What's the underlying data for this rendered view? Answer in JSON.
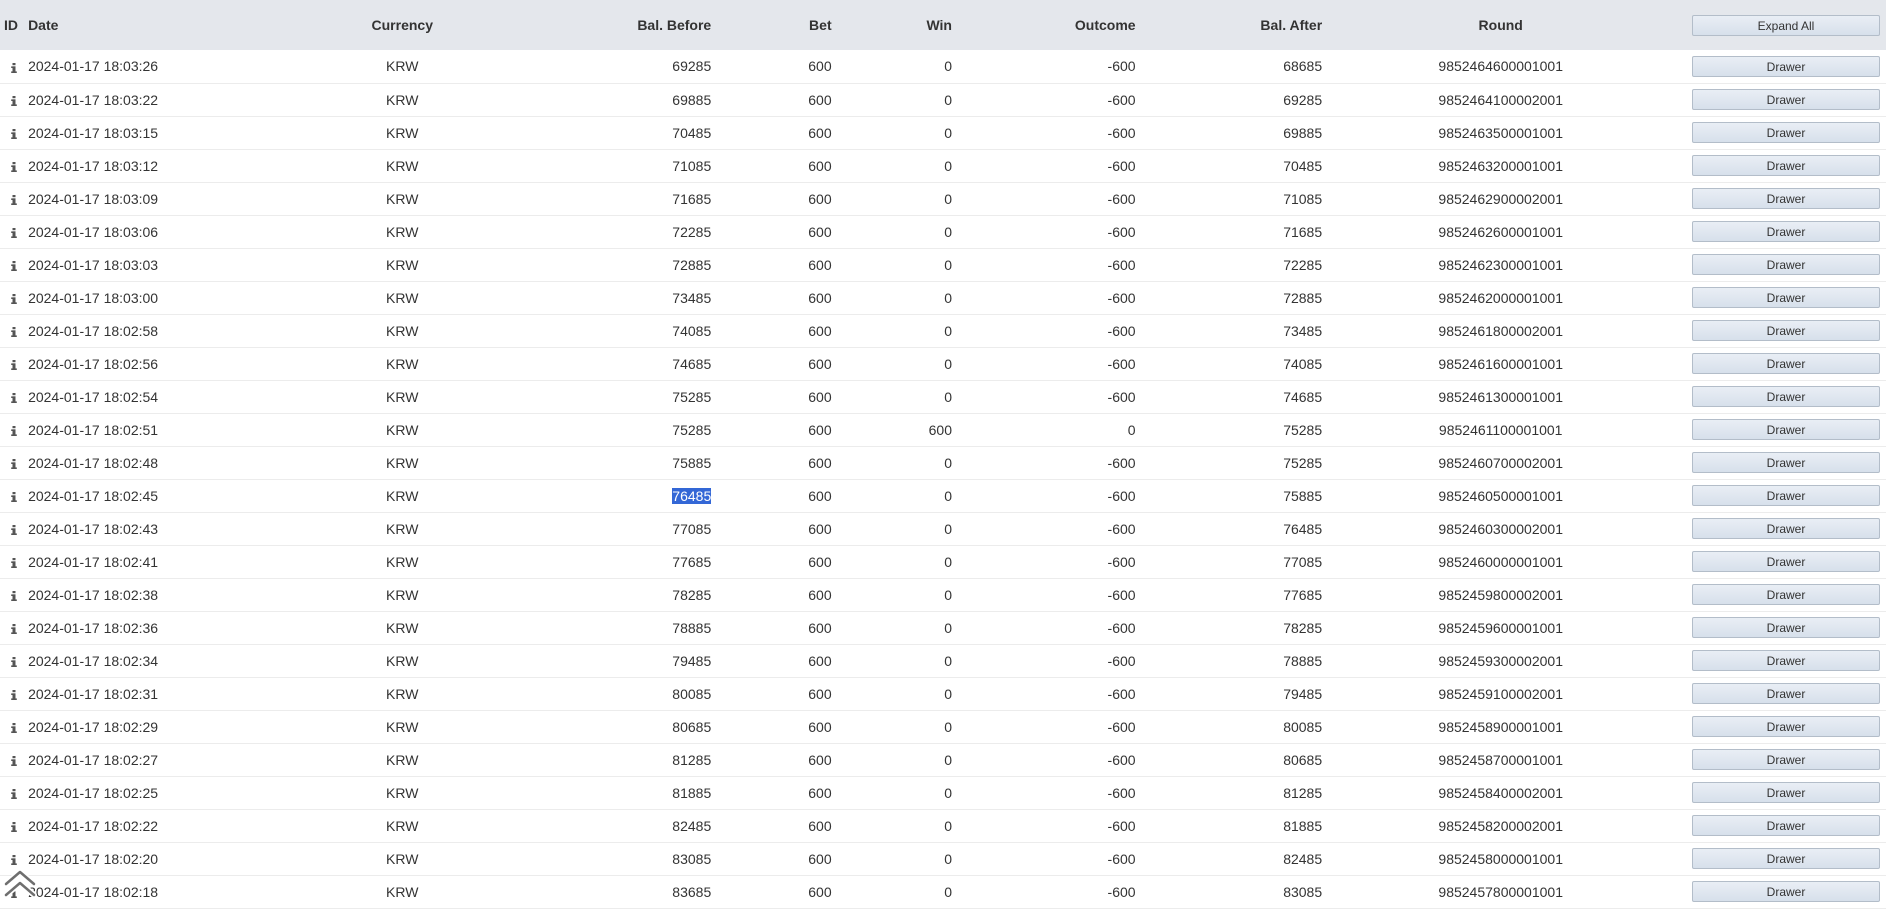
{
  "columns": {
    "id": "ID",
    "date": "Date",
    "currency": "Currency",
    "bal_before": "Bal. Before",
    "bet": "Bet",
    "win": "Win",
    "outcome": "Outcome",
    "bal_after": "Bal. After",
    "round": "Round"
  },
  "expand_all_label": "Expand All",
  "row_button_label": "Drawer",
  "icons": {
    "row_info": "info-icon",
    "scroll_top": "double-chevron-up-icon"
  },
  "colors": {
    "header_bg": "#e4e7ec",
    "selection": "#3367d6"
  },
  "selected_cell": {
    "row": 13,
    "column": "bal_before"
  },
  "rows": [
    {
      "date": "2024-01-17 18:03:26",
      "currency": "KRW",
      "bal_before": "69285",
      "bet": "600",
      "win": "0",
      "outcome": "-600",
      "bal_after": "68685",
      "round": "9852464600001001"
    },
    {
      "date": "2024-01-17 18:03:22",
      "currency": "KRW",
      "bal_before": "69885",
      "bet": "600",
      "win": "0",
      "outcome": "-600",
      "bal_after": "69285",
      "round": "9852464100002001"
    },
    {
      "date": "2024-01-17 18:03:15",
      "currency": "KRW",
      "bal_before": "70485",
      "bet": "600",
      "win": "0",
      "outcome": "-600",
      "bal_after": "69885",
      "round": "9852463500001001"
    },
    {
      "date": "2024-01-17 18:03:12",
      "currency": "KRW",
      "bal_before": "71085",
      "bet": "600",
      "win": "0",
      "outcome": "-600",
      "bal_after": "70485",
      "round": "9852463200001001"
    },
    {
      "date": "2024-01-17 18:03:09",
      "currency": "KRW",
      "bal_before": "71685",
      "bet": "600",
      "win": "0",
      "outcome": "-600",
      "bal_after": "71085",
      "round": "9852462900002001"
    },
    {
      "date": "2024-01-17 18:03:06",
      "currency": "KRW",
      "bal_before": "72285",
      "bet": "600",
      "win": "0",
      "outcome": "-600",
      "bal_after": "71685",
      "round": "9852462600001001"
    },
    {
      "date": "2024-01-17 18:03:03",
      "currency": "KRW",
      "bal_before": "72885",
      "bet": "600",
      "win": "0",
      "outcome": "-600",
      "bal_after": "72285",
      "round": "9852462300001001"
    },
    {
      "date": "2024-01-17 18:03:00",
      "currency": "KRW",
      "bal_before": "73485",
      "bet": "600",
      "win": "0",
      "outcome": "-600",
      "bal_after": "72885",
      "round": "9852462000001001"
    },
    {
      "date": "2024-01-17 18:02:58",
      "currency": "KRW",
      "bal_before": "74085",
      "bet": "600",
      "win": "0",
      "outcome": "-600",
      "bal_after": "73485",
      "round": "9852461800002001"
    },
    {
      "date": "2024-01-17 18:02:56",
      "currency": "KRW",
      "bal_before": "74685",
      "bet": "600",
      "win": "0",
      "outcome": "-600",
      "bal_after": "74085",
      "round": "9852461600001001"
    },
    {
      "date": "2024-01-17 18:02:54",
      "currency": "KRW",
      "bal_before": "75285",
      "bet": "600",
      "win": "0",
      "outcome": "-600",
      "bal_after": "74685",
      "round": "9852461300001001"
    },
    {
      "date": "2024-01-17 18:02:51",
      "currency": "KRW",
      "bal_before": "75285",
      "bet": "600",
      "win": "600",
      "outcome": "0",
      "bal_after": "75285",
      "round": "9852461100001001"
    },
    {
      "date": "2024-01-17 18:02:48",
      "currency": "KRW",
      "bal_before": "75885",
      "bet": "600",
      "win": "0",
      "outcome": "-600",
      "bal_after": "75285",
      "round": "9852460700002001"
    },
    {
      "date": "2024-01-17 18:02:45",
      "currency": "KRW",
      "bal_before": "76485",
      "bet": "600",
      "win": "0",
      "outcome": "-600",
      "bal_after": "75885",
      "round": "9852460500001001"
    },
    {
      "date": "2024-01-17 18:02:43",
      "currency": "KRW",
      "bal_before": "77085",
      "bet": "600",
      "win": "0",
      "outcome": "-600",
      "bal_after": "76485",
      "round": "9852460300002001"
    },
    {
      "date": "2024-01-17 18:02:41",
      "currency": "KRW",
      "bal_before": "77685",
      "bet": "600",
      "win": "0",
      "outcome": "-600",
      "bal_after": "77085",
      "round": "9852460000001001"
    },
    {
      "date": "2024-01-17 18:02:38",
      "currency": "KRW",
      "bal_before": "78285",
      "bet": "600",
      "win": "0",
      "outcome": "-600",
      "bal_after": "77685",
      "round": "9852459800002001"
    },
    {
      "date": "2024-01-17 18:02:36",
      "currency": "KRW",
      "bal_before": "78885",
      "bet": "600",
      "win": "0",
      "outcome": "-600",
      "bal_after": "78285",
      "round": "9852459600001001"
    },
    {
      "date": "2024-01-17 18:02:34",
      "currency": "KRW",
      "bal_before": "79485",
      "bet": "600",
      "win": "0",
      "outcome": "-600",
      "bal_after": "78885",
      "round": "9852459300002001"
    },
    {
      "date": "2024-01-17 18:02:31",
      "currency": "KRW",
      "bal_before": "80085",
      "bet": "600",
      "win": "0",
      "outcome": "-600",
      "bal_after": "79485",
      "round": "9852459100002001"
    },
    {
      "date": "2024-01-17 18:02:29",
      "currency": "KRW",
      "bal_before": "80685",
      "bet": "600",
      "win": "0",
      "outcome": "-600",
      "bal_after": "80085",
      "round": "9852458900001001"
    },
    {
      "date": "2024-01-17 18:02:27",
      "currency": "KRW",
      "bal_before": "81285",
      "bet": "600",
      "win": "0",
      "outcome": "-600",
      "bal_after": "80685",
      "round": "9852458700001001"
    },
    {
      "date": "2024-01-17 18:02:25",
      "currency": "KRW",
      "bal_before": "81885",
      "bet": "600",
      "win": "0",
      "outcome": "-600",
      "bal_after": "81285",
      "round": "9852458400002001"
    },
    {
      "date": "2024-01-17 18:02:22",
      "currency": "KRW",
      "bal_before": "82485",
      "bet": "600",
      "win": "0",
      "outcome": "-600",
      "bal_after": "81885",
      "round": "9852458200002001"
    },
    {
      "date": "2024-01-17 18:02:20",
      "currency": "KRW",
      "bal_before": "83085",
      "bet": "600",
      "win": "0",
      "outcome": "-600",
      "bal_after": "82485",
      "round": "9852458000001001"
    },
    {
      "date": "2024-01-17 18:02:18",
      "currency": "KRW",
      "bal_before": "83685",
      "bet": "600",
      "win": "0",
      "outcome": "-600",
      "bal_after": "83085",
      "round": "9852457800001001"
    }
  ]
}
